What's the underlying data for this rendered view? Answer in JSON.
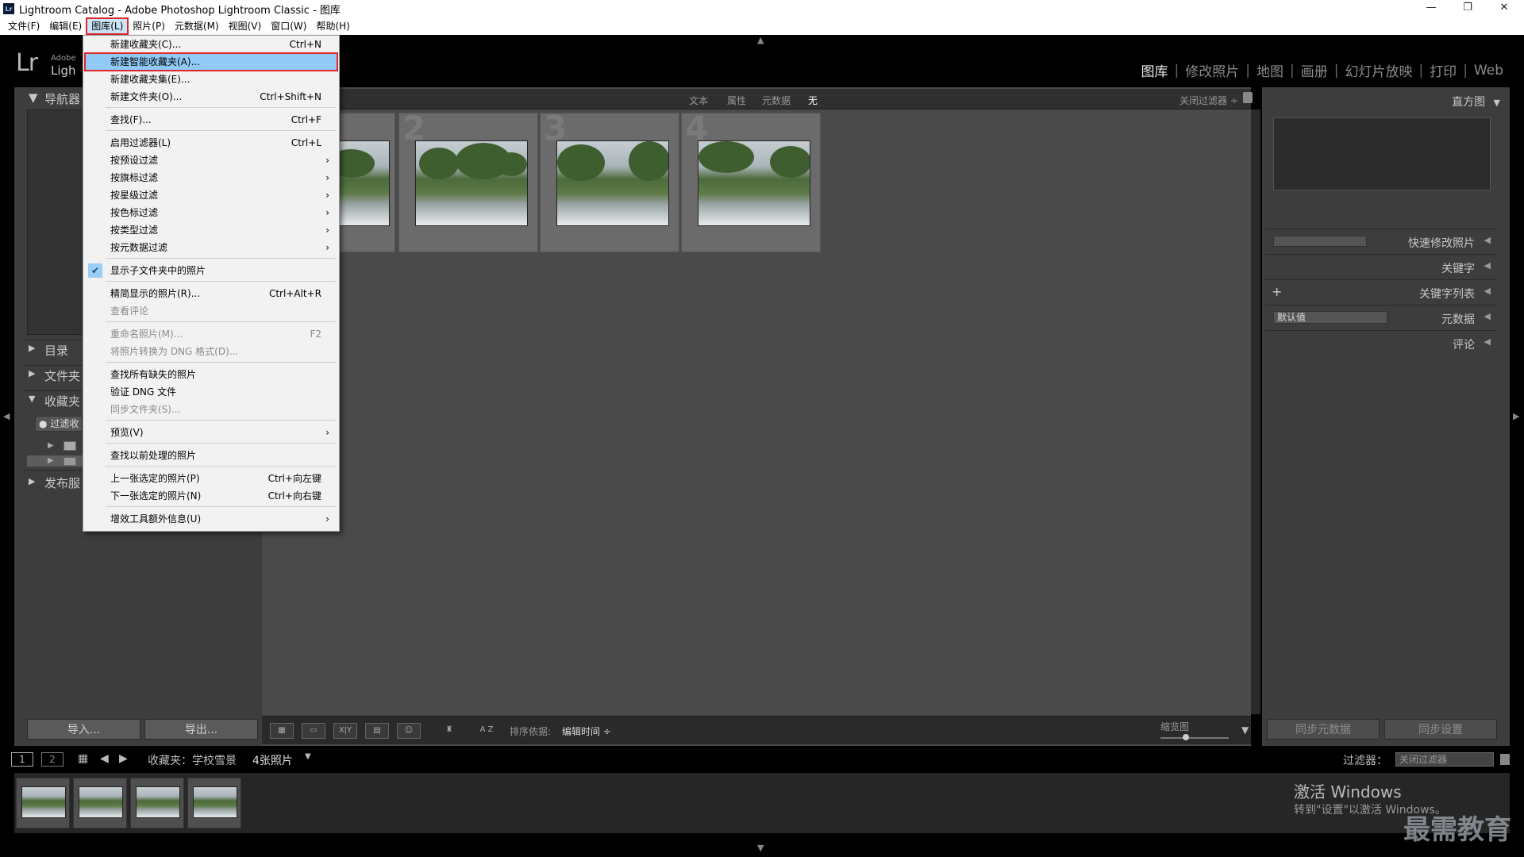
{
  "window": {
    "title": "Lightroom Catalog - Adobe Photoshop Lightroom Classic - 图库",
    "app_icon": "Lr"
  },
  "menubar": [
    "文件(F)",
    "编辑(E)",
    "图库(L)",
    "照片(P)",
    "元数据(M)",
    "视图(V)",
    "窗口(W)",
    "帮助(H)"
  ],
  "brand": {
    "logo": "Lr",
    "line1": "Adobe",
    "line2": "Ligh"
  },
  "modules": [
    "图库",
    "修改照片",
    "地图",
    "画册",
    "幻灯片放映",
    "打印",
    "Web"
  ],
  "module_sep": "|",
  "left_panel": {
    "navigator": "导航器",
    "catalog": "目录",
    "folders": "文件夹",
    "collections": "收藏夹",
    "filter": "过滤收",
    "publish": "发布服",
    "import": "导入...",
    "export": "导出..."
  },
  "filterbar": {
    "text": "文本",
    "attribute": "属性",
    "metadata": "元数据",
    "none": "无",
    "filters_off": "关闭过滤器 ÷"
  },
  "grid": {
    "numbers": [
      "2",
      "3",
      "4"
    ]
  },
  "toolbar": {
    "sort_label": "排序依据:",
    "sort_value": "编辑时间 ÷",
    "thumb_label": "缩览图",
    "az": "A Z",
    "xy": "X|Y"
  },
  "right_panel": {
    "histogram": "直方图",
    "quick_develop": "快速修改照片",
    "keywording": "关键字",
    "keyword_list": "关键字列表",
    "metadata": "元数据",
    "metadata_preset": "默认值",
    "comments": "评论",
    "sync_metadata": "同步元数据",
    "sync_settings": "同步设置",
    "plus": "+"
  },
  "filmbar": {
    "page1": "1",
    "page2": "2",
    "source": "收藏夹：学校雪景",
    "count": "4张照片",
    "filter_label": "过滤器：",
    "filter_value": "关闭过滤器"
  },
  "watermark": {
    "line1": "激活 Windows",
    "line2": "转到\"设置\"以激活 Windows。",
    "brand": "最需教育"
  },
  "dropdown": [
    {
      "label": "新建收藏夹(C)...",
      "shortcut": "Ctrl+N"
    },
    {
      "label": "新建智能收藏夹(A)...",
      "shortcut": ""
    },
    {
      "label": "新建收藏夹集(E)...",
      "shortcut": ""
    },
    {
      "label": "新建文件夹(O)...",
      "shortcut": "Ctrl+Shift+N"
    },
    {
      "label": "查找(F)...",
      "shortcut": "Ctrl+F"
    },
    {
      "label": "启用过滤器(L)",
      "shortcut": "Ctrl+L"
    },
    {
      "label": "按预设过滤",
      "shortcut": ""
    },
    {
      "label": "按旗标过滤",
      "shortcut": ""
    },
    {
      "label": "按星级过滤",
      "shortcut": ""
    },
    {
      "label": "按色标过滤",
      "shortcut": ""
    },
    {
      "label": "按类型过滤",
      "shortcut": ""
    },
    {
      "label": "按元数据过滤",
      "shortcut": ""
    },
    {
      "label": "显示子文件夹中的照片",
      "shortcut": ""
    },
    {
      "label": "精简显示的照片(R)...",
      "shortcut": "Ctrl+Alt+R"
    },
    {
      "label": "查看评论",
      "shortcut": ""
    },
    {
      "label": "重命名照片(M)...",
      "shortcut": "F2"
    },
    {
      "label": "将照片转换为 DNG 格式(D)...",
      "shortcut": ""
    },
    {
      "label": "查找所有缺失的照片",
      "shortcut": ""
    },
    {
      "label": "验证 DNG 文件",
      "shortcut": ""
    },
    {
      "label": "同步文件夹(S)...",
      "shortcut": ""
    },
    {
      "label": "预览(V)",
      "shortcut": ""
    },
    {
      "label": "查找以前处理的照片",
      "shortcut": ""
    },
    {
      "label": "上一张选定的照片(P)",
      "shortcut": "Ctrl+向左键"
    },
    {
      "label": "下一张选定的照片(N)",
      "shortcut": "Ctrl+向右键"
    },
    {
      "label": "增效工具额外信息(U)",
      "shortcut": ""
    }
  ],
  "dropdown_submenu_arrow": "›",
  "dropdown_check": "✔"
}
